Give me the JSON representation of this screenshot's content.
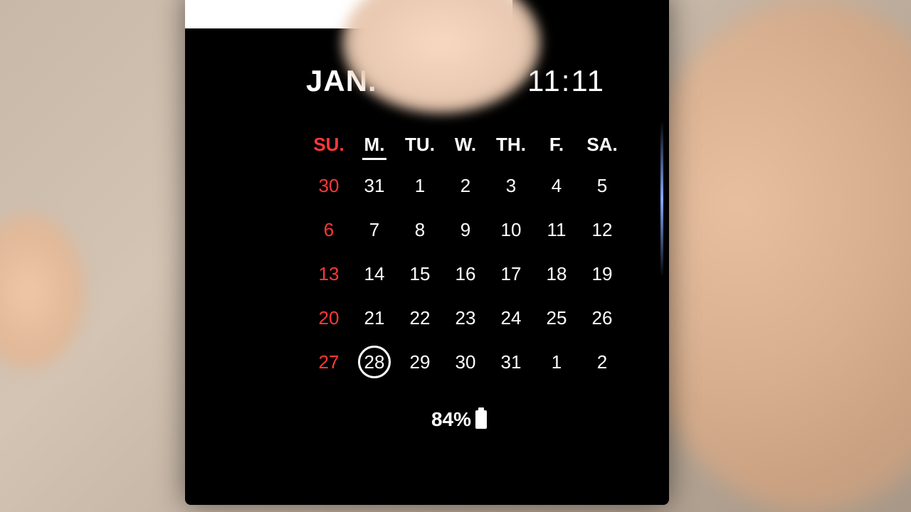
{
  "header": {
    "month": "JAN.",
    "time": "11:11"
  },
  "weekdays": [
    "SU.",
    "M.",
    "TU.",
    "W.",
    "TH.",
    "F.",
    "SA."
  ],
  "today_column_index": 1,
  "grid": [
    [
      "30",
      "31",
      "1",
      "2",
      "3",
      "4",
      "5"
    ],
    [
      "6",
      "7",
      "8",
      "9",
      "10",
      "11",
      "12"
    ],
    [
      "13",
      "14",
      "15",
      "16",
      "17",
      "18",
      "19"
    ],
    [
      "20",
      "21",
      "22",
      "23",
      "24",
      "25",
      "26"
    ],
    [
      "27",
      "28",
      "29",
      "30",
      "31",
      "1",
      "2"
    ]
  ],
  "today": {
    "row": 4,
    "col": 1,
    "value": "28"
  },
  "battery": {
    "percent_label": "84%"
  }
}
